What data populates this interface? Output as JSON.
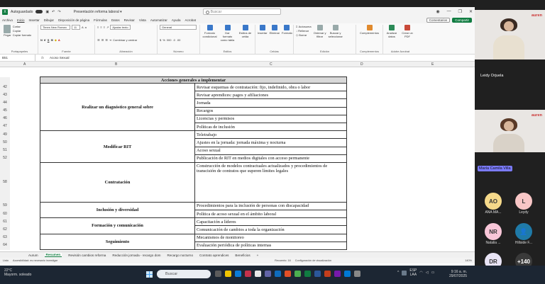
{
  "excel": {
    "autosave_label": "Autoguardado",
    "doc_title": "Presentación reforma laboral ▾",
    "search_placeholder": "Buscar",
    "menu": [
      "Archivo",
      "Inicio",
      "Insertar",
      "Dibujar",
      "Disposición de página",
      "Fórmulas",
      "Datos",
      "Revisar",
      "Vista",
      "Automatizar",
      "Ayuda",
      "Acrobat"
    ],
    "comments_btn": "Comentarios",
    "share_btn": "Compartir",
    "ribbon": {
      "paste": "Pegar",
      "cut": "Cortar",
      "copy": "Copiar",
      "format_painter": "Copiar formato",
      "clipboard_group": "Portapapeles",
      "font_name": "Times New Roman",
      "font_size": "11",
      "font_group": "Fuente",
      "wrap_text": "Ajustar texto",
      "merge_center": "Combinar y centrar",
      "alignment_group": "Alineación",
      "number_format": "General",
      "number_group": "Número",
      "cond_format": "Formato condicional",
      "format_table": "Dar formato como tabla",
      "cell_styles": "Estilos de celda",
      "styles_group": "Estilos",
      "insert": "Insertar",
      "delete": "Eliminar",
      "format": "Formato",
      "cells_group": "Celdas",
      "autosum": "Autosuma",
      "fill": "Rellenar",
      "clear": "Borrar",
      "sort_filter": "Ordenar y filtrar",
      "find_select": "Buscar y seleccionar",
      "editing_group": "Edición",
      "addins": "Complementos",
      "addins_group": "Complementos",
      "analyze": "Analizar datos",
      "create_pdf": "Crear un PDF",
      "adobe_group": "Adobe Acrobat"
    },
    "name_box": "B51",
    "formula": "Acoso Sexual",
    "columns": [
      "A",
      "B",
      "C",
      "D",
      "E"
    ],
    "table_header": "Acciones generales a implementar",
    "rows": [
      {
        "num": "42",
        "left": "",
        "right": "Revisar esquemas de contratación: fijo, indefinido, obra o labor"
      },
      {
        "num": "43",
        "left": "",
        "right": "Revisar aprendices: pagos y afiliaciones"
      },
      {
        "num": "44",
        "left": "",
        "right": "Jornada"
      },
      {
        "num": "45",
        "left": "",
        "right": "Recargos"
      },
      {
        "num": "46",
        "left": "",
        "right": "Licencias y permisos"
      },
      {
        "num": "47",
        "left": "",
        "right": "Políticas de inclusión"
      },
      {
        "num": "49",
        "left": "",
        "right": "Teletrabajo"
      },
      {
        "num": "50",
        "left": "",
        "right": "Ajustes en la jornada: jornada máxima y nocturna"
      },
      {
        "num": "51",
        "left": "",
        "right": "Acoso sexual"
      },
      {
        "num": "52",
        "left": "",
        "right": "Publicación de RIT en medios digitales con acceso permanente"
      },
      {
        "num": "58",
        "left": "",
        "right": "Construcción de modelos contractuales actualizados y procedimientos de transcisión de contratos que superen límites legales"
      },
      {
        "num": "59",
        "left": "",
        "right": "Procedimientos para la inclusión de personas con discapacidad"
      },
      {
        "num": "60",
        "left": "",
        "right": "Política de acoso sexual en el ámbito laboral"
      },
      {
        "num": "61",
        "left": "",
        "right": "Capacitación a líderes"
      },
      {
        "num": "62",
        "left": "",
        "right": "Comunicación de cambios a toda la organización"
      },
      {
        "num": "63",
        "left": "",
        "right": "Mecanismos de monitoreo"
      },
      {
        "num": "64",
        "left": "",
        "right": "Evaluación periódica de políticas internas"
      }
    ],
    "groups": [
      "Realizar un diagnóstico general sobre",
      "Modificar RIT",
      "Contratación",
      "Inclusión y diversidad",
      "Formación y comunicación",
      "Seguimiento"
    ],
    "sheet_tabs": [
      "Aurum",
      "Resumen",
      "Revisión cambios reforma",
      "Reducción jornada - recargo dom",
      "Recargo nocturno",
      "Contrato aprendices",
      "Beneficios"
    ],
    "active_tab": "Resumen",
    "status": {
      "ready": "Listo",
      "accessibility": "Accesibilidad: es necesario investigar",
      "count": "Recuento: 16",
      "display_settings": "Configuración de visualización",
      "zoom": "140%"
    }
  },
  "meeting": {
    "participant1": "Leidy Orjuela",
    "participant2": "María Camila Villa",
    "brand": "auren",
    "avatars": [
      {
        "initials": "AO",
        "label": "ANA MA...",
        "color": "#f5d98a",
        "text": "#333"
      },
      {
        "initials": "L",
        "label": "Leydy",
        "color": "#f8c6c6",
        "text": "#333"
      },
      {
        "initials": "NR",
        "label": "Natalia ...",
        "color": "#f8c6d8",
        "text": "#333"
      },
      {
        "initials": "",
        "label": "Hillside F...",
        "color": "#1f7aa8",
        "text": "#fff"
      },
      {
        "initials": "DR",
        "label": "Dina Req...",
        "color": "#e9e4f5",
        "text": "#333"
      },
      {
        "initials": "+140",
        "label": "",
        "color": "#3a3a3a",
        "text": "#fff"
      }
    ]
  },
  "taskbar": {
    "weather_temp": "22°C",
    "weather_desc": "Mayorm. soleado",
    "search": "Buscar",
    "lang1": "ESP",
    "lang2": "LAA",
    "time": "9:16 a. m.",
    "date": "29/07/2025"
  }
}
